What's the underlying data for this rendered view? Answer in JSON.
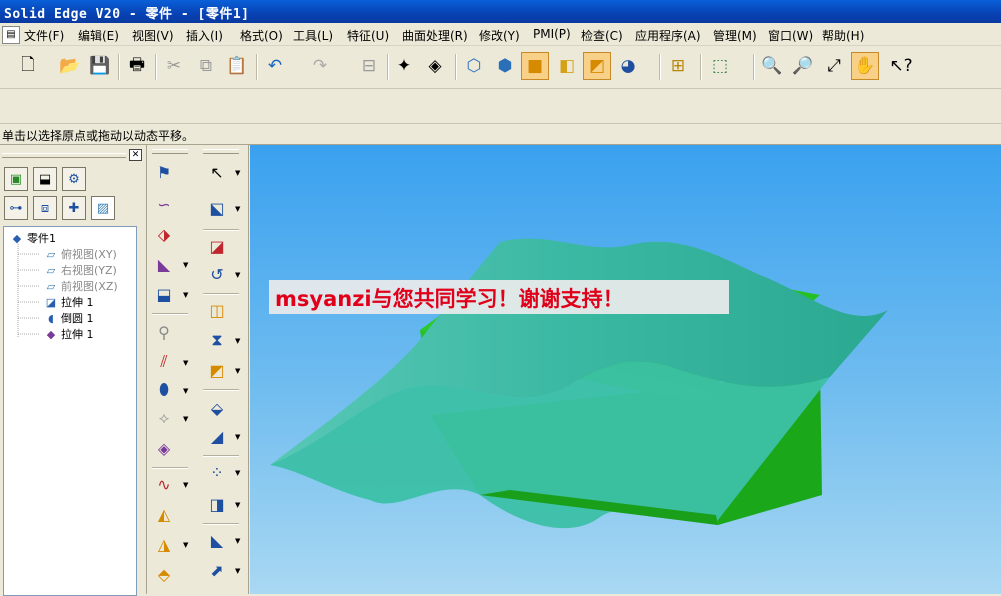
{
  "window": {
    "title": "Solid Edge V20 - 零件 - [零件1]"
  },
  "menu": [
    {
      "label": "文件(F)"
    },
    {
      "label": "编辑(E)"
    },
    {
      "label": "视图(V)"
    },
    {
      "label": "插入(I)"
    },
    {
      "label": "格式(O)"
    },
    {
      "label": "工具(L)"
    },
    {
      "label": "特征(U)"
    },
    {
      "label": "曲面处理(R)"
    },
    {
      "label": "修改(Y)"
    },
    {
      "label": "PMI(P)"
    },
    {
      "label": "检查(C)"
    },
    {
      "label": "应用程序(A)"
    },
    {
      "label": "管理(M)"
    },
    {
      "label": "窗口(W)"
    },
    {
      "label": "帮助(H)"
    }
  ],
  "status": {
    "prompt": "单击以选择原点或拖动以动态平移。"
  },
  "tree": {
    "items": [
      {
        "label": "零件1"
      },
      {
        "label": "俯视图(XY)"
      },
      {
        "label": "右视图(YZ)"
      },
      {
        "label": "前视图(XZ)"
      },
      {
        "label": "拉伸 1"
      },
      {
        "label": "倒圆 1"
      },
      {
        "label": "拉伸 1"
      }
    ]
  },
  "overlay": {
    "text": "msyanzi与您共同学习！谢谢支持！"
  },
  "colors": {
    "solid": "#1fbf1f",
    "surface": "#3cc0a6",
    "banner_text": "#e0001a",
    "viewport_top": "#3aa1ef",
    "viewport_bottom": "#a9d8f2"
  }
}
